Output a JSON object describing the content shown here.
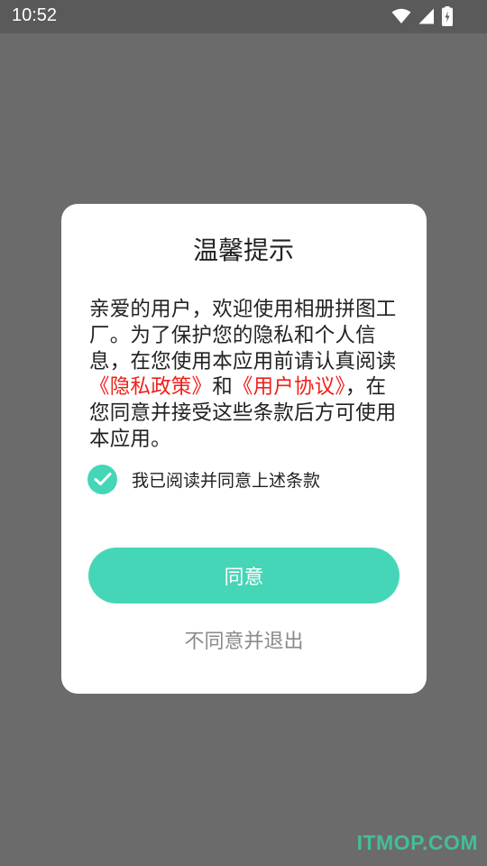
{
  "status_bar": {
    "time": "10:52",
    "icons": [
      "wifi-icon",
      "signal-icon",
      "battery-charging-icon"
    ]
  },
  "dialog": {
    "title": "温馨提示",
    "message": {
      "part1": "亲爱的用户，欢迎使用相册拼图工厂。为了保护您的隐私和个人信息，在您使用本应用前请认真阅读",
      "privacy_link": "《隐私政策》",
      "conjunction": "和",
      "agreement_link": "《用户协议》",
      "part2": "，在您同意并接受这些条款后方可使用本应用。"
    },
    "consent": {
      "checked": true,
      "label": "我已阅读并同意上述条款"
    },
    "agree_label": "同意",
    "disagree_label": "不同意并退出"
  },
  "watermark": "ITMOP.COM",
  "colors": {
    "accent": "#45d6b7",
    "link": "#f0201a",
    "overlay": "#6b6b6b",
    "secondary_text": "#8a8a8a"
  }
}
